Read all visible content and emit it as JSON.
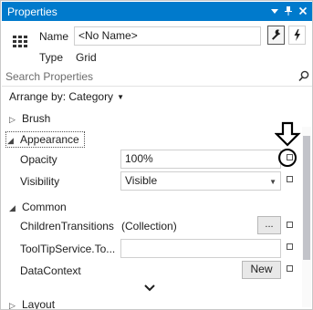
{
  "window": {
    "title": "Properties",
    "title_icons": [
      "dropdown-arrow-icon",
      "pin-icon",
      "close-icon"
    ],
    "accent_color": "#007acc"
  },
  "header": {
    "name_label": "Name",
    "name_value": "<No Name>",
    "type_label": "Type",
    "type_value": "Grid",
    "view_buttons": [
      "wrench-icon",
      "lightning-icon"
    ]
  },
  "search": {
    "placeholder": "Search Properties"
  },
  "arrange": {
    "label": "Arrange by: Category"
  },
  "categories": {
    "brush": "Brush",
    "appearance": "Appearance",
    "common": "Common",
    "layout": "Layout"
  },
  "properties": {
    "opacity": {
      "name": "Opacity",
      "value": "100%"
    },
    "visibility": {
      "name": "Visibility",
      "value": "Visible"
    },
    "children_transitions": {
      "name": "ChildrenTransitions",
      "value": "(Collection)",
      "button": "..."
    },
    "tooltip": {
      "name": "ToolTipService.To...",
      "value": ""
    },
    "datacontext": {
      "name": "DataContext",
      "button": "New"
    }
  }
}
